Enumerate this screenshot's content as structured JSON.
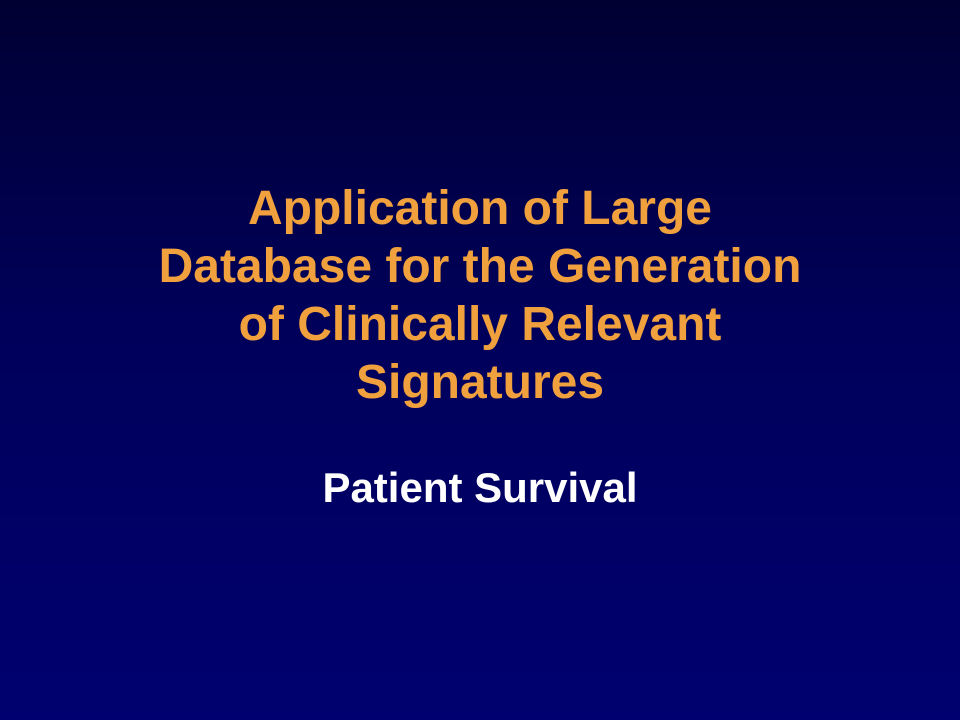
{
  "slide": {
    "title_lines": [
      "Application of Large",
      "Database for the Generation",
      "of Clinically Relevant",
      "Signatures"
    ],
    "subtitle": "Patient Survival"
  },
  "colors": {
    "background_top": "#000033",
    "background_bottom": "#000070",
    "title": "#f0a03c",
    "subtitle": "#ffffff"
  }
}
